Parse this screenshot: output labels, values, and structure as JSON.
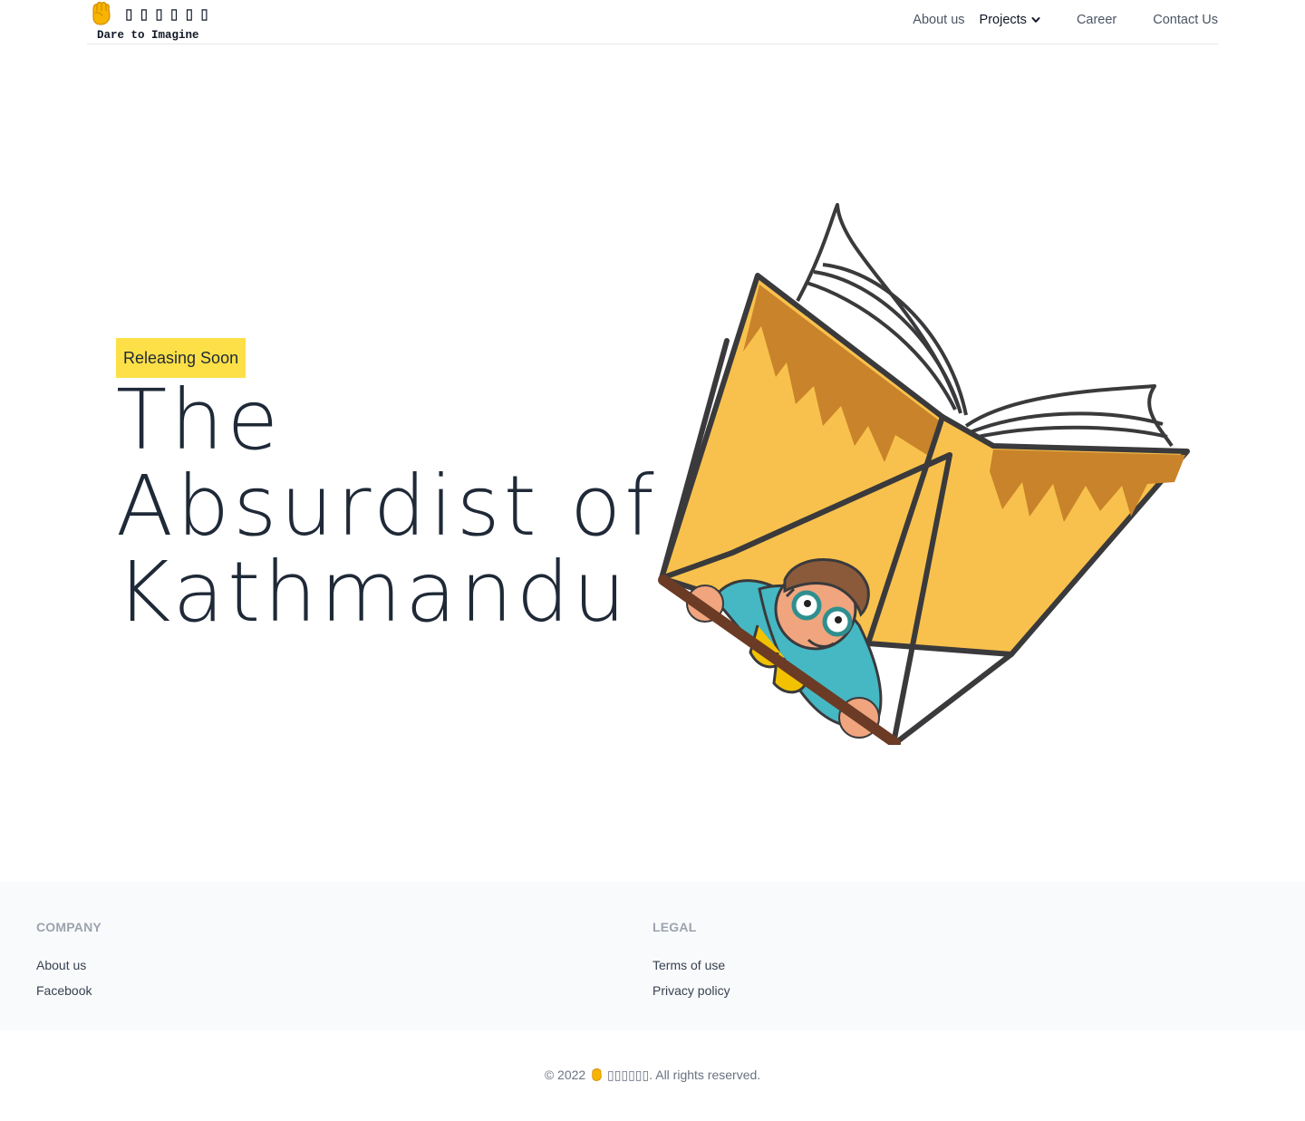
{
  "brand": {
    "icon": "raised-fist-icon",
    "name": "▯▯▯▯▯▯",
    "tagline": "Dare to Imagine"
  },
  "nav": {
    "about": "About us",
    "projects": "Projects",
    "career": "Career",
    "contact": "Contact Us"
  },
  "hero": {
    "badge": "Releasing Soon",
    "title_lines": [
      "The",
      "Absurdist of",
      "Kathmandu"
    ],
    "illustration": "boy-flying-book-glider-illustration"
  },
  "footer": {
    "company": {
      "heading": "Company",
      "links": [
        "About us",
        "Facebook"
      ]
    },
    "legal": {
      "heading": "Legal",
      "links": [
        "Terms of use",
        "Privacy policy"
      ]
    },
    "copyright_prefix": "© 2022",
    "copyright_brand": "▯▯▯▯▯▯",
    "copyright_suffix": ". All rights reserved."
  },
  "colors": {
    "badge": "#fde047",
    "book": "#f8c14d",
    "book_shadow": "#c9832a",
    "outline": "#3a3a3c",
    "shirt": "#45b8c4",
    "glider_bar": "#6b3b26"
  }
}
